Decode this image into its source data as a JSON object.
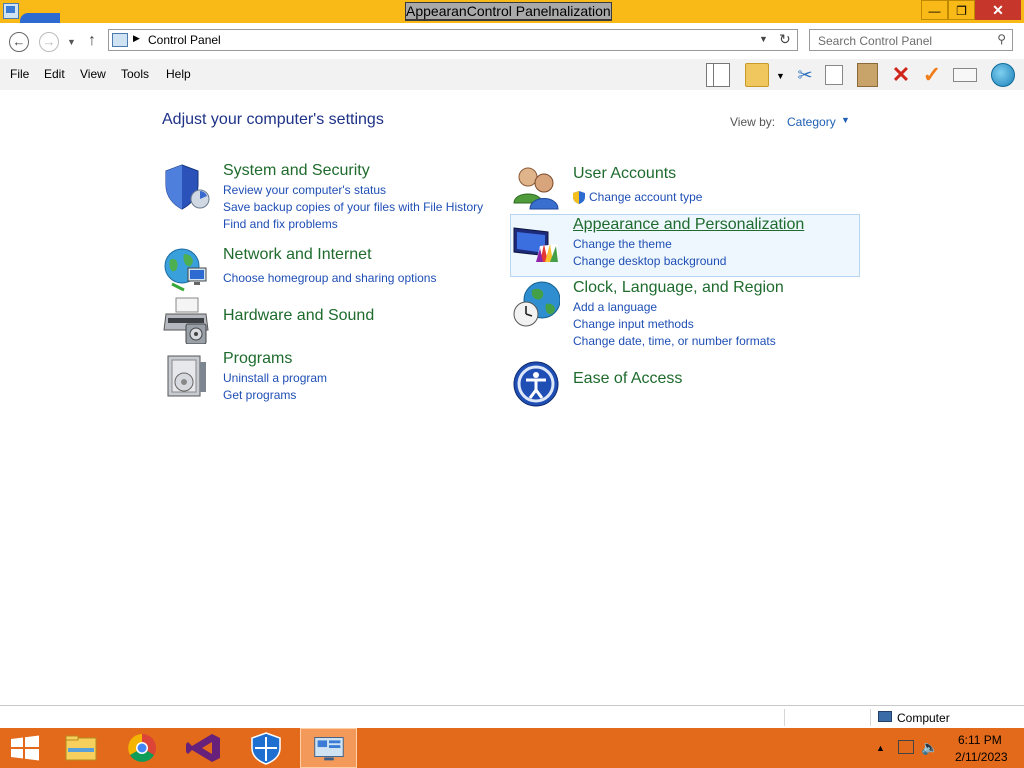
{
  "window": {
    "title": "AppearanControl Panelnalization",
    "minimize_label": "—",
    "maximize_label": "❐",
    "close_label": "✕"
  },
  "nav": {
    "back_icon": "back-arrow-icon",
    "forward_icon": "forward-arrow-icon",
    "up_icon": "up-arrow-icon",
    "breadcrumb": "Control Panel",
    "search_placeholder": "Search Control Panel"
  },
  "menu": {
    "items": [
      "File",
      "Edit",
      "View",
      "Tools",
      "Help"
    ]
  },
  "toolbar": {
    "icons": [
      "layout-icon",
      "folder-options-icon",
      "cut-icon",
      "copy-icon",
      "paste-icon",
      "delete-icon",
      "checkmark-icon",
      "properties-icon",
      "globe-icon"
    ]
  },
  "content": {
    "title": "Adjust your computer's settings",
    "view_by_label": "View by:",
    "view_by_value": "Category",
    "categories": [
      {
        "heading": "System and Security",
        "icon": "shield-icon",
        "links": [
          "Review your computer's status",
          "Save backup copies of your files with File History",
          "Find and fix problems"
        ]
      },
      {
        "heading": "Network and Internet",
        "icon": "network-globe-icon",
        "links": [
          "Choose homegroup and sharing options"
        ]
      },
      {
        "heading": "Hardware and Sound",
        "icon": "printer-icon",
        "links": []
      },
      {
        "heading": "Programs",
        "icon": "programs-icon",
        "links": [
          "Uninstall a program",
          "Get programs"
        ]
      },
      {
        "heading": "User Accounts",
        "icon": "users-icon",
        "links": [
          "Change account type"
        ]
      },
      {
        "heading": "Appearance and Personalization",
        "icon": "display-color-icon",
        "links": [
          "Change the theme",
          "Change desktop background"
        ]
      },
      {
        "heading": "Clock, Language, and Region",
        "icon": "clock-globe-icon",
        "links": [
          "Add a language",
          "Change input methods",
          "Change date, time, or number formats"
        ]
      },
      {
        "heading": "Ease of Access",
        "icon": "ease-of-access-icon",
        "links": []
      }
    ]
  },
  "statusbar": {
    "location": "Computer"
  },
  "taskbar": {
    "apps": [
      "start-icon",
      "file-explorer-icon",
      "chrome-icon",
      "visual-studio-icon",
      "defender-icon",
      "control-panel-icon"
    ],
    "time": "6:11 PM",
    "date": "2/11/2023"
  },
  "colors": {
    "title_bar": "#f9b917",
    "taskbar": "#e36a1a",
    "heading_green": "#1e6b2d",
    "link_blue": "#1f4fb5",
    "page_title_blue": "#1e3287"
  }
}
